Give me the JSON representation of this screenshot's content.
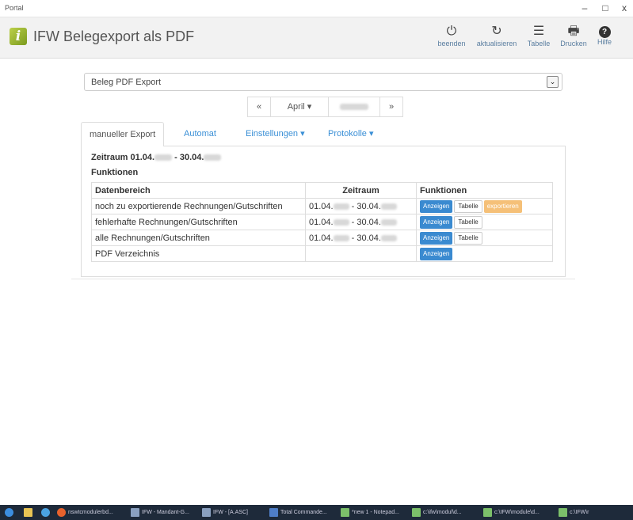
{
  "window": {
    "title": "Portal",
    "controls": [
      "–",
      "□",
      "x"
    ]
  },
  "app": {
    "title": "IFW Belegexport als PDF",
    "logo_letter": "i",
    "toolbar": [
      {
        "name": "beenden-button",
        "icon": "power-icon",
        "glyph": "⏻",
        "label": "beenden"
      },
      {
        "name": "aktualisieren-button",
        "icon": "refresh-icon",
        "glyph": "↻",
        "label": "aktualisieren"
      },
      {
        "name": "tabelle-button",
        "icon": "list-icon",
        "glyph": "☰",
        "label": "Tabelle"
      },
      {
        "name": "drucken-button",
        "icon": "printer-icon",
        "glyph": "🖶",
        "label": "Drucken"
      },
      {
        "name": "hilfe-button",
        "icon": "help-icon",
        "glyph": "?",
        "label": "Hilfe"
      }
    ]
  },
  "select": {
    "value": "Beleg PDF Export",
    "arrow_icon": "chevron-down-icon",
    "arrow_glyph": "⌄"
  },
  "pager": {
    "prev": "«",
    "month": "April ▾",
    "next": "»"
  },
  "tabs": [
    {
      "label": "manueller Export",
      "active": true
    },
    {
      "label": "Automat"
    },
    {
      "label": "Einstellungen ▾"
    },
    {
      "label": "Protokolle ▾"
    }
  ],
  "panel": {
    "zeitraum_prefix": "Zeitraum 01.04.",
    "zeitraum_mid": " - 30.04.",
    "funktionen_title": "Funktionen",
    "headers": [
      "Datenbereich",
      "Zeitraum",
      "Funktionen"
    ],
    "rows": [
      {
        "label": "noch zu exportierende Rechnungen/Gutschriften",
        "from": "01.04.",
        "to": "- 30.04.",
        "buttons": [
          "Anzeigen",
          "Tabelle",
          "exportieren"
        ]
      },
      {
        "label": "fehlerhafte Rechnungen/Gutschriften",
        "from": "01.04.",
        "to": "- 30.04.",
        "buttons": [
          "Anzeigen",
          "Tabelle"
        ]
      },
      {
        "label": "alle Rechnungen/Gutschriften",
        "from": "01.04.",
        "to": "- 30.04.",
        "buttons": [
          "Anzeigen",
          "Tabelle"
        ]
      },
      {
        "label": "PDF Verzeichnis",
        "from": "",
        "to": "",
        "buttons": [
          "Anzeigen"
        ]
      }
    ]
  },
  "taskbar": {
    "items": [
      "nswtcmodulerbd...",
      "IFW - Mandant-G...",
      "IFW - [A.ASC]",
      "Total Commande...",
      "*new 1 - Notepad...",
      "c:\\ifw\\modul\\d...",
      "c:\\IFW\\module\\d...",
      "c:\\IFW\\r"
    ]
  }
}
